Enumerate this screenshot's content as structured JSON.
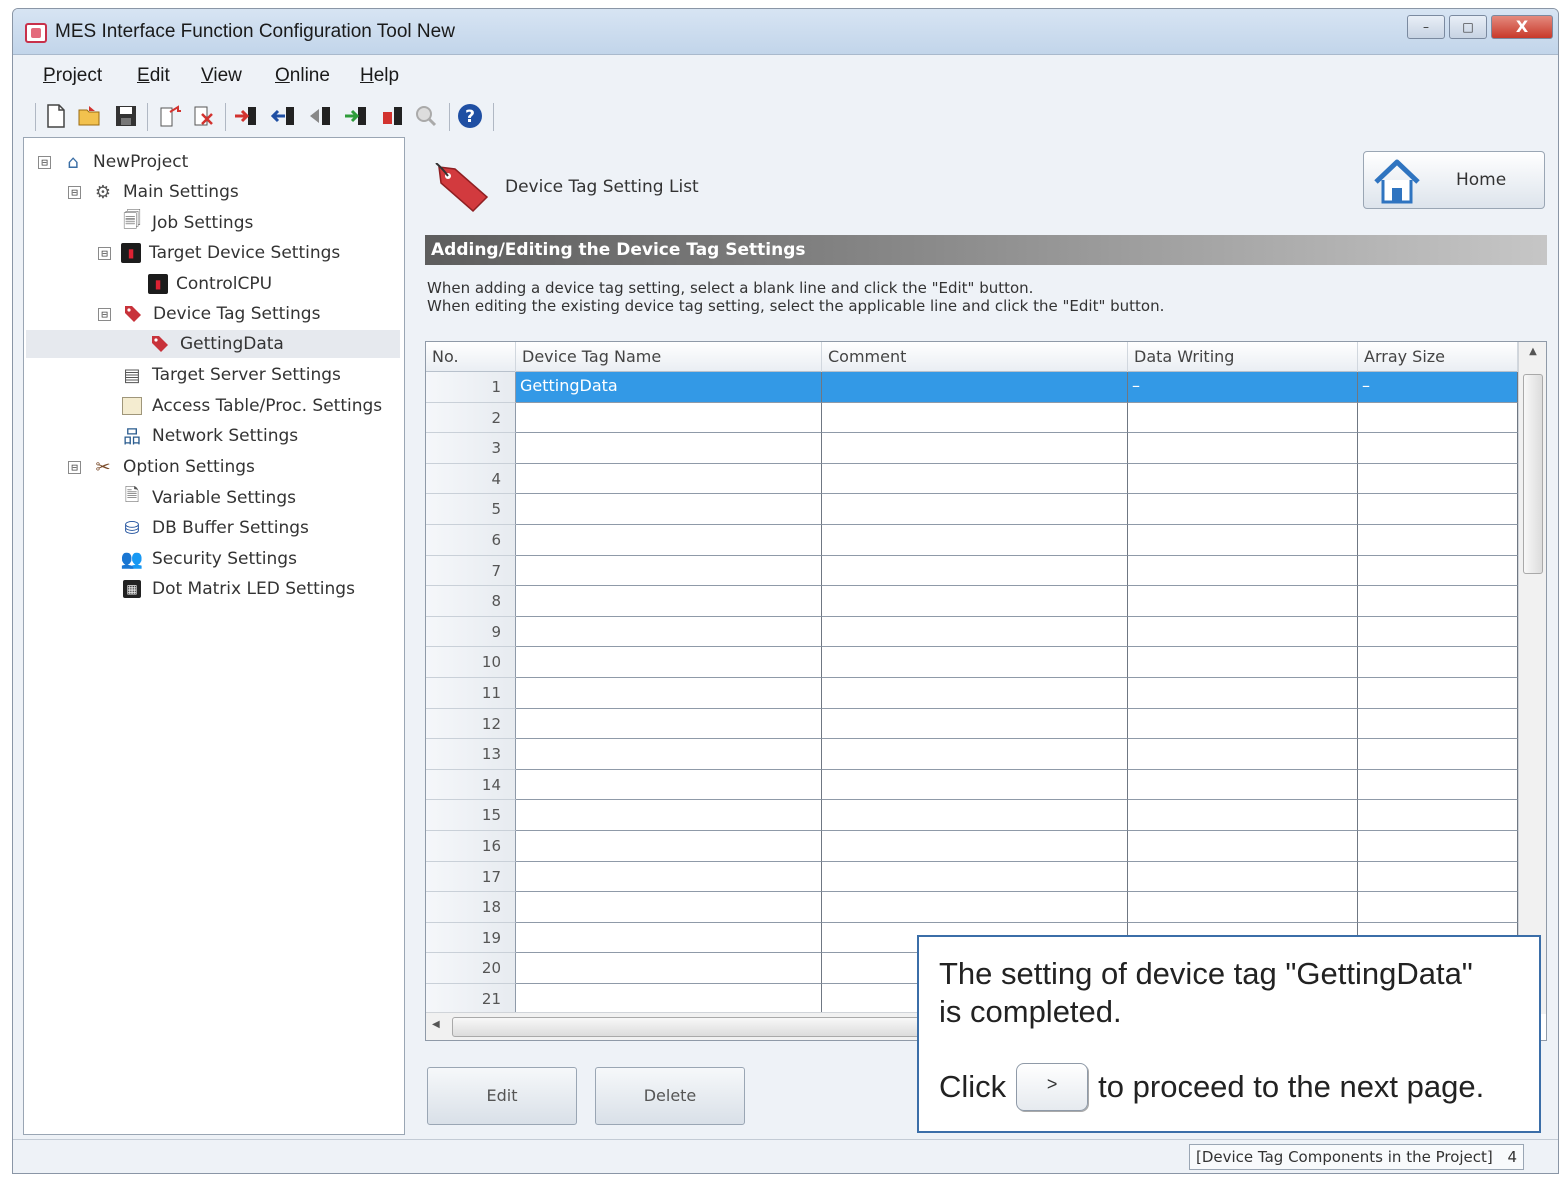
{
  "window": {
    "title": "MES Interface Function Configuration Tool New",
    "controls": [
      "–",
      "□",
      "X"
    ]
  },
  "menu": [
    "Project",
    "Edit",
    "View",
    "Online",
    "Help"
  ],
  "toolbar_icons": [
    "new-file",
    "open-folder",
    "save",
    "export",
    "delete",
    "read-from",
    "write-to",
    "verify",
    "transfer",
    "stop",
    "disabled-search",
    "help"
  ],
  "tree": {
    "items": [
      {
        "label": "NewProject",
        "icon": "house",
        "level": 0,
        "expander": "⊟"
      },
      {
        "label": "Main Settings",
        "icon": "gear",
        "level": 1,
        "expander": "⊟"
      },
      {
        "label": "Job Settings",
        "icon": "document",
        "level": 2,
        "expander": ""
      },
      {
        "label": "Target Device Settings",
        "icon": "cpu",
        "level": 2,
        "expander": "⊟"
      },
      {
        "label": "ControlCPU",
        "icon": "cpu",
        "level": 3,
        "expander": ""
      },
      {
        "label": "Device Tag Settings",
        "icon": "tag",
        "level": 2,
        "expander": "⊟"
      },
      {
        "label": "GettingData",
        "icon": "tag",
        "level": 3,
        "expander": "",
        "selected": true
      },
      {
        "label": "Target Server Settings",
        "icon": "server",
        "level": 2,
        "expander": ""
      },
      {
        "label": "Access Table/Proc. Settings",
        "icon": "table",
        "level": 2,
        "expander": ""
      },
      {
        "label": "Network Settings",
        "icon": "network",
        "level": 2,
        "expander": ""
      },
      {
        "label": "Option Settings",
        "icon": "tools",
        "level": 1,
        "expander": "⊟"
      },
      {
        "label": "Variable Settings",
        "icon": "variable",
        "level": 2,
        "expander": ""
      },
      {
        "label": "DB Buffer Settings",
        "icon": "database",
        "level": 2,
        "expander": ""
      },
      {
        "label": "Security Settings",
        "icon": "security",
        "level": 2,
        "expander": ""
      },
      {
        "label": "Dot Matrix LED Settings",
        "icon": "led",
        "level": 2,
        "expander": ""
      }
    ]
  },
  "main": {
    "header_title": "Device Tag Setting List",
    "home_label": "Home",
    "section_title": "Adding/Editing the Device Tag Settings",
    "instructions": [
      "When adding a device tag setting, select a blank line and click the \"Edit\" button.",
      "When editing the existing device tag setting, select the applicable line and click the \"Edit\" button."
    ],
    "columns": [
      "No.",
      "Device Tag Name",
      "Comment",
      "Data Writing",
      "Array Size"
    ],
    "rows": [
      {
        "no": "1",
        "name": "GettingData",
        "comment": "",
        "data_writing": "–",
        "array_size": "–",
        "selected": true
      },
      {
        "no": "2"
      },
      {
        "no": "3"
      },
      {
        "no": "4"
      },
      {
        "no": "5"
      },
      {
        "no": "6"
      },
      {
        "no": "7"
      },
      {
        "no": "8"
      },
      {
        "no": "9"
      },
      {
        "no": "10"
      },
      {
        "no": "11"
      },
      {
        "no": "12"
      },
      {
        "no": "13"
      },
      {
        "no": "14"
      },
      {
        "no": "15"
      },
      {
        "no": "16"
      },
      {
        "no": "17"
      },
      {
        "no": "18"
      },
      {
        "no": "19"
      },
      {
        "no": "20"
      },
      {
        "no": "21"
      }
    ],
    "edit_label": "Edit",
    "delete_label": "Delete"
  },
  "status": {
    "text": "[Device Tag Components in the Project]",
    "count": "4"
  },
  "callout": {
    "line1": "The setting of device tag \"GettingData\"",
    "line2": "is completed.",
    "click": "Click",
    "button": ">",
    "after": "to proceed to the next page."
  },
  "colors": {
    "selection": "#3399e6",
    "section_bar": "#5d5d5d",
    "tag_red": "#c8323a",
    "callout_border": "#3b6ea8"
  }
}
